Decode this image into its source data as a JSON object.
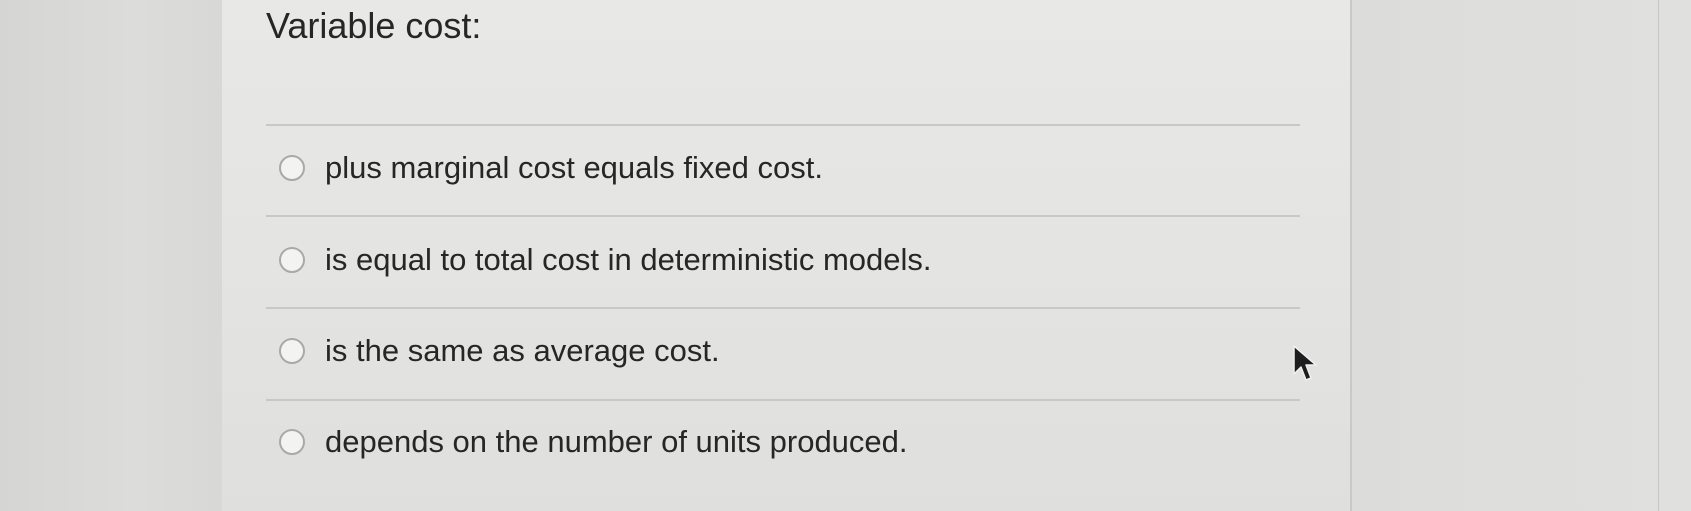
{
  "question": {
    "title": "Variable cost:"
  },
  "options": [
    {
      "label": "plus marginal cost equals fixed cost."
    },
    {
      "label": "is equal to total cost in deterministic models."
    },
    {
      "label": "is the same as average cost."
    },
    {
      "label": "depends on the number of units produced."
    }
  ],
  "icons": {
    "cursor": "mouse-pointer-icon",
    "radio": "radio-button-unselected"
  },
  "colors": {
    "background": "#dcdcda",
    "panel": "#e6e6e4",
    "text": "#262626",
    "divider": "#c8c8c6"
  }
}
